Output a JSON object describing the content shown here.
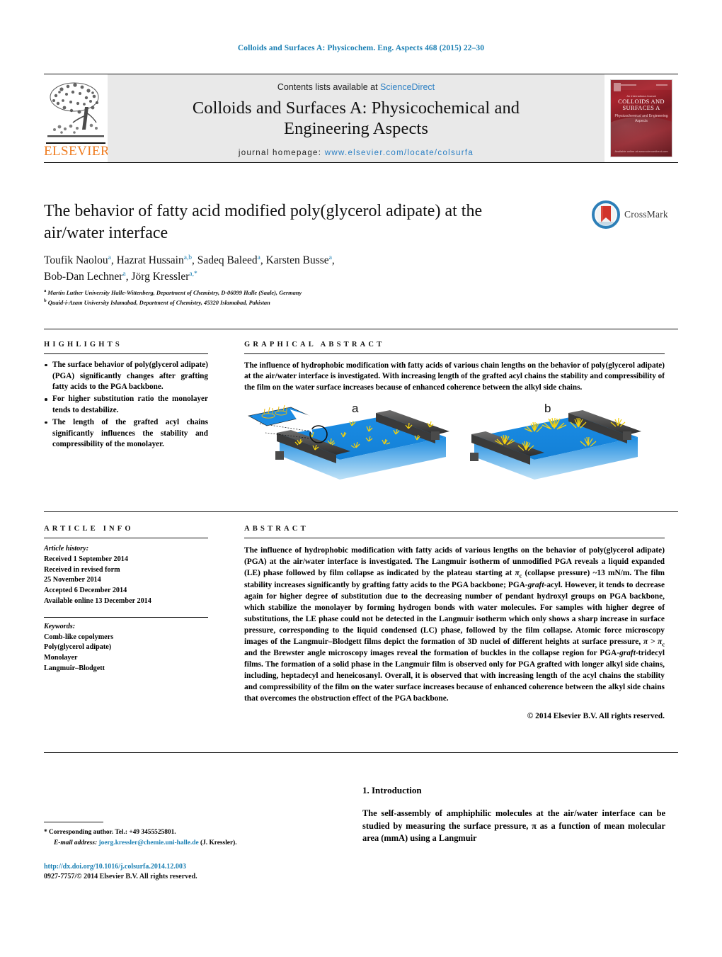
{
  "running_head": "Colloids and Surfaces A: Physicochem. Eng. Aspects 468 (2015) 22–30",
  "masthead": {
    "contents_prefix": "Contents lists available at ",
    "sciencedirect": "ScienceDirect",
    "journal_title_line1": "Colloids and Surfaces A: Physicochemical and",
    "journal_title_line2": "Engineering Aspects",
    "homepage_prefix": "journal homepage:",
    "homepage_url": "www.elsevier.com/locate/colsurfa",
    "publisher": "ELSEVIER",
    "cover": {
      "kicker": "An Internationa Journal",
      "title_line1": "COLLOIDS AND",
      "title_line2": "SURFACES A",
      "subtitle": "Physicochemical and Engineering Aspects",
      "footer": "Available online at www.sciencedirect.com"
    }
  },
  "article": {
    "title": "The behavior of fatty acid modified poly(glycerol adipate) at the air/water interface",
    "authors": [
      {
        "name": "Toufik Naolou",
        "marks": "a"
      },
      {
        "name": "Hazrat Hussain",
        "marks": "a,b"
      },
      {
        "name": "Sadeq Baleed",
        "marks": "a"
      },
      {
        "name": "Karsten Busse",
        "marks": "a"
      },
      {
        "name": "Bob-Dan Lechner",
        "marks": "a"
      },
      {
        "name": "Jörg Kressler",
        "marks": "a,*"
      }
    ],
    "affiliations": [
      {
        "mark": "a",
        "text": "Martin Luther University Halle-Wittenberg, Department of Chemistry, D-06099 Halle (Saale), Germany"
      },
      {
        "mark": "b",
        "text": "Quaid-i-Azam University Islamabad, Department of Chemistry, 45320 Islamabad, Pakistan"
      }
    ],
    "crossmark_label": "CrossMark"
  },
  "highlights": {
    "heading": "HIGHLIGHTS",
    "items": [
      "The surface behavior of poly(glycerol adipate) (PGA) significantly changes after grafting fatty acids to the PGA backbone.",
      "For higher substitution ratio the monolayer tends to destabilize.",
      "The length of the grafted acyl chains significantly influences the stability and compressibility of the monolayer."
    ]
  },
  "graphical_abstract": {
    "heading": "GRAPHICAL ABSTRACT",
    "text": "The influence of hydrophobic modification with fatty acids of various chain lengths on the behavior of poly(glycerol adipate) at the air/water interface is investigated. With increasing length of the grafted acyl chains the stability and compressibility of the film on the water surface increases because of enhanced coherence between the alkyl side chains.",
    "figure": {
      "panel_a_label": "a",
      "panel_b_label": "b",
      "water_color": "#1d8fe0",
      "barrier_color": "#4a4a4a",
      "molecule_color": "#f2d411"
    }
  },
  "article_info": {
    "heading": "ARTICLE INFO",
    "history_label": "Article history:",
    "history": [
      "Received 1 September 2014",
      "Received in revised form",
      "25 November 2014",
      "Accepted 6 December 2014",
      "Available online 13 December 2014"
    ],
    "keywords_label": "Keywords:",
    "keywords": [
      "Comb-like copolymers",
      "Poly(glycerol adipate)",
      "Monolayer",
      "Langmuir–Blodgett"
    ]
  },
  "abstract": {
    "heading": "ABSTRACT",
    "paragraph_part1": "The influence of hydrophobic modification with fatty acids of various lengths on the behavior of poly(glycerol adipate) (PGA) at the air/water interface is investigated. The Langmuir isotherm of unmodified PGA reveals a liquid expanded (LE) phase followed by film collapse as indicated by the plateau starting at ",
    "pi_symbol": "π",
    "pi_subscript": "c",
    "paragraph_part2": " (collapse pressure) ~13 mN/m. The film stability increases significantly by grafting fatty acids to the PGA backbone; PGA-",
    "graft_italic": "graft",
    "paragraph_part3": "-acyl. However, it tends to decrease again for higher degree of substitution due to the decreasing number of pendant hydroxyl groups on PGA backbone, which stabilize the monolayer by forming hydrogen bonds with water molecules. For samples with higher degree of substitutions, the LE phase could not be detected in the Langmuir isotherm which only shows a sharp increase in surface pressure, corresponding to the liquid condensed (LC) phase, followed by the film collapse. Atomic force microscopy images of the Langmuir–Blodgett films depict the formation of 3D nuclei of different heights at surface pressure, ",
    "paragraph_part4": " and the Brewster angle microscopy images reveal the formation of buckles in the collapse region for PGA-",
    "paragraph_part5": "-tridecyl films. The formation of a solid phase in the Langmuir film is observed only for PGA grafted with longer alkyl side chains, including, heptadecyl and heneicosanyl. Overall, it is observed that with increasing length of the acyl chains the stability and compressibility of the film on the water surface increases because of enhanced coherence between the alkyl side chains that overcomes the obstruction effect of the PGA backbone.",
    "pi_gt": "π > π",
    "copyright": "© 2014 Elsevier B.V. All rights reserved."
  },
  "introduction": {
    "heading": "1.  Introduction",
    "text": "The self-assembly of amphiphilic molecules at the air/water interface can be studied by measuring the surface pressure, π as a function of mean molecular area (mmA) using a Langmuir"
  },
  "footer": {
    "corresponding": "*  Corresponding author. Tel.: +49 3455525801.",
    "email_label": "E-mail address:",
    "email": "joerg.kressler@chemie.uni-halle.de",
    "email_suffix": "(J. Kressler).",
    "doi": "http://dx.doi.org/10.1016/j.colsurfa.2014.12.003",
    "issn": "0927-7757/© 2014 Elsevier B.V. All rights reserved."
  }
}
